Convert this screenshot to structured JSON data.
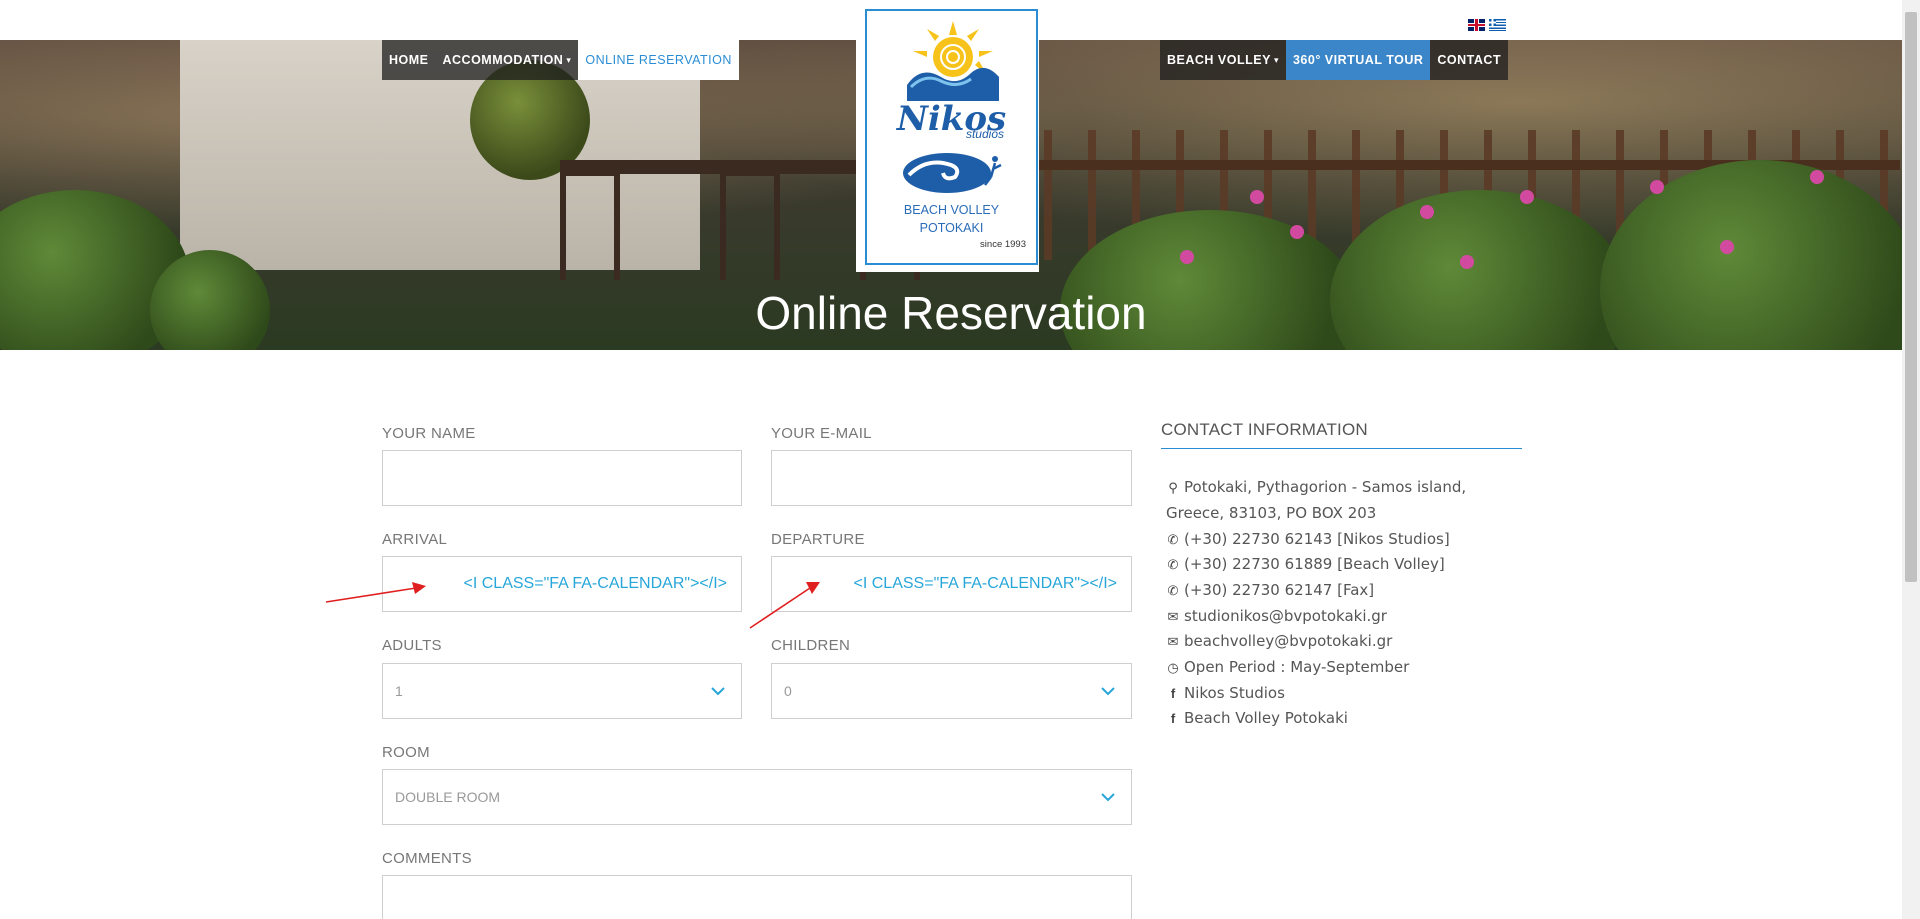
{
  "nav": {
    "left": [
      {
        "label": "HOME"
      },
      {
        "label": "ACCOMMODATION",
        "caret": "▾"
      },
      {
        "label": "ONLINE RESERVATION"
      }
    ],
    "right": [
      {
        "label": "BEACH VOLLEY",
        "caret": "▾"
      },
      {
        "label": "360° VIRTUAL TOUR"
      },
      {
        "label": "CONTACT"
      }
    ],
    "languages": [
      "en-flag-icon",
      "gr-flag-icon"
    ]
  },
  "logo": {
    "name": "Nikos",
    "sub": "studios",
    "beach_volley_1": "BEACH VOLLEY",
    "beach_volley_2": "POTOKAKI",
    "since": "since 1993"
  },
  "hero": {
    "title": "Online Reservation"
  },
  "form": {
    "name_label": "YOUR NAME",
    "email_label": "YOUR E-MAIL",
    "arrival_label": "ARRIVAL",
    "arrival_value": "<I CLASS=\"FA FA-CALENDAR\"></I>",
    "departure_label": "DEPARTURE",
    "departure_value": "<I CLASS=\"FA FA-CALENDAR\"></I>",
    "adults_label": "ADULTS",
    "adults_value": "1",
    "children_label": "CHILDREN",
    "children_value": "0",
    "room_label": "ROOM",
    "room_value": "DOUBLE ROOM",
    "comments_label": "COMMENTS"
  },
  "contact": {
    "title": "CONTACT INFORMATION",
    "address_1": "Potokaki, Pythagorion - Samos island,",
    "address_2": "Greece, 83103, PO BOX 203",
    "phone_1": "(+30) 22730 62143 [Nikos Studios]",
    "phone_2": "(+30) 22730 61889 [Beach Volley]",
    "fax": "(+30) 22730 62147 [Fax]",
    "email_1": "studionikos@bvpotokaki.gr",
    "email_2": "beachvolley@bvpotokaki.gr",
    "open": "Open Period : May-September",
    "fb_1": "Nikos Studios",
    "fb_2": "Beach Volley Potokaki"
  },
  "colors": {
    "accent": "#2a8dd4",
    "calendar_text": "#27a6d9",
    "annotation_arrow": "#e02020"
  }
}
